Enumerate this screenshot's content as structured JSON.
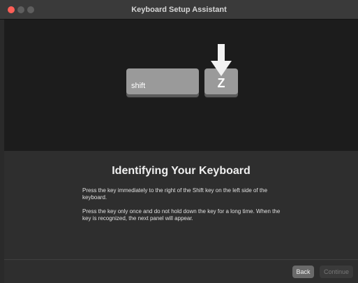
{
  "window": {
    "title": "Keyboard Setup Assistant"
  },
  "illustration": {
    "shift_key_label": "shift",
    "target_key_label": "Z"
  },
  "content": {
    "heading": "Identifying Your Keyboard",
    "paragraph1": "Press the key immediately to the right of the Shift key on the left side of the keyboard.",
    "paragraph2": "Press the key only once and do not hold down the key for a long time. When the key is recognized, the next panel will appear."
  },
  "footer": {
    "back_label": "Back",
    "continue_label": "Continue",
    "continue_enabled": false
  },
  "colors": {
    "close_button": "#ff5f57",
    "key_face": "#9a9a9a",
    "arrow": "#f2f2f2"
  }
}
